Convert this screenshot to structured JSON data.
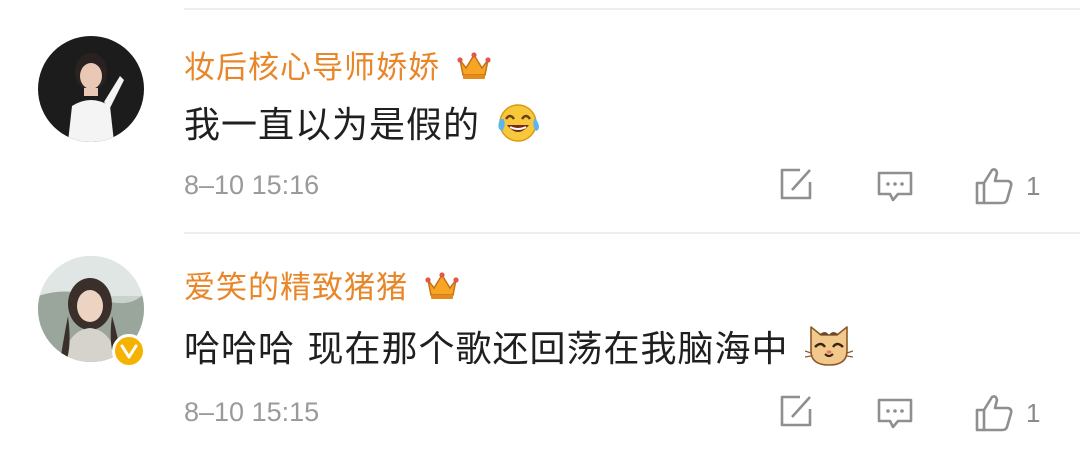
{
  "comments": [
    {
      "username": "妆后核心导师娇娇",
      "text": "我一直以为是假的",
      "emoji": "laughing-tears-emoji",
      "timestamp": "8–10 15:16",
      "likes": "1",
      "verified": false
    },
    {
      "username": "爱笑的精致猪猪",
      "text": "哈哈哈 现在那个歌还回荡在我脑海中",
      "emoji": "cat-face-emoji",
      "timestamp": "8–10 15:15",
      "likes": "1",
      "verified": true
    }
  ],
  "colors": {
    "username": "#e8862a",
    "text": "#1f1f1f",
    "meta": "#9a9a9a",
    "icon": "#8f8f8f",
    "badge": "#f6b200"
  }
}
